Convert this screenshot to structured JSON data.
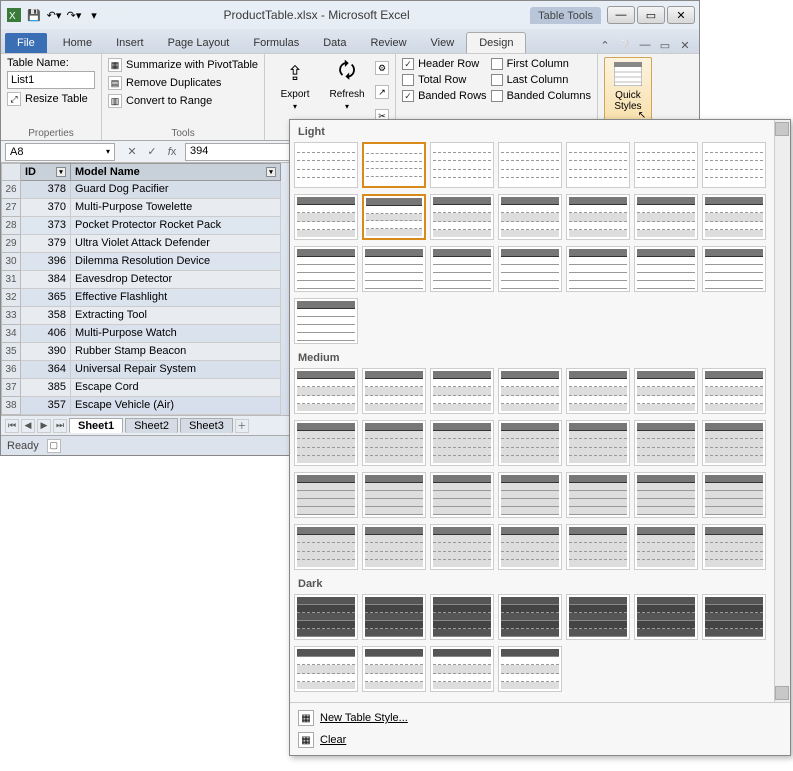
{
  "titlebar": {
    "title": "ProductTable.xlsx - Microsoft Excel",
    "table_tools": "Table Tools"
  },
  "tabs": {
    "file": "File",
    "home": "Home",
    "insert": "Insert",
    "pagelayout": "Page Layout",
    "formulas": "Formulas",
    "data": "Data",
    "review": "Review",
    "view": "View",
    "design": "Design"
  },
  "ribbon": {
    "properties": {
      "label": "Properties",
      "tablename_label": "Table Name:",
      "tablename_value": "List1",
      "resize": "Resize Table"
    },
    "tools": {
      "label": "Tools",
      "pivot": "Summarize with PivotTable",
      "dup": "Remove Duplicates",
      "range": "Convert to Range"
    },
    "external": {
      "export": "Export",
      "refresh": "Refresh"
    },
    "styleoptions": {
      "header": "Header Row",
      "total": "Total Row",
      "bandedr": "Banded Rows",
      "firstcol": "First Column",
      "lastcol": "Last Column",
      "bandedc": "Banded Columns"
    },
    "quickstyles": "Quick Styles"
  },
  "formula": {
    "cellref": "A8",
    "value": "394"
  },
  "sheet": {
    "headers": {
      "id": "ID",
      "model": "Model Name"
    },
    "rows": [
      {
        "n": "26",
        "id": "378",
        "name": "Guard Dog Pacifier"
      },
      {
        "n": "27",
        "id": "370",
        "name": "Multi-Purpose Towelette"
      },
      {
        "n": "28",
        "id": "373",
        "name": "Pocket Protector Rocket Pack"
      },
      {
        "n": "29",
        "id": "379",
        "name": "Ultra Violet Attack Defender"
      },
      {
        "n": "30",
        "id": "396",
        "name": "Dilemma Resolution Device"
      },
      {
        "n": "31",
        "id": "384",
        "name": "Eavesdrop Detector"
      },
      {
        "n": "32",
        "id": "365",
        "name": "Effective Flashlight"
      },
      {
        "n": "33",
        "id": "358",
        "name": "Extracting Tool"
      },
      {
        "n": "34",
        "id": "406",
        "name": "Multi-Purpose Watch"
      },
      {
        "n": "35",
        "id": "390",
        "name": "Rubber Stamp Beacon"
      },
      {
        "n": "36",
        "id": "364",
        "name": "Universal Repair System"
      },
      {
        "n": "37",
        "id": "385",
        "name": "Escape Cord"
      },
      {
        "n": "38",
        "id": "357",
        "name": "Escape Vehicle (Air)"
      }
    ]
  },
  "sheettabs": {
    "s1": "Sheet1",
    "s2": "Sheet2",
    "s3": "Sheet3"
  },
  "status": {
    "ready": "Ready"
  },
  "styles": {
    "light": "Light",
    "medium": "Medium",
    "dark": "Dark",
    "new": "New Table Style...",
    "clear": "Clear"
  }
}
